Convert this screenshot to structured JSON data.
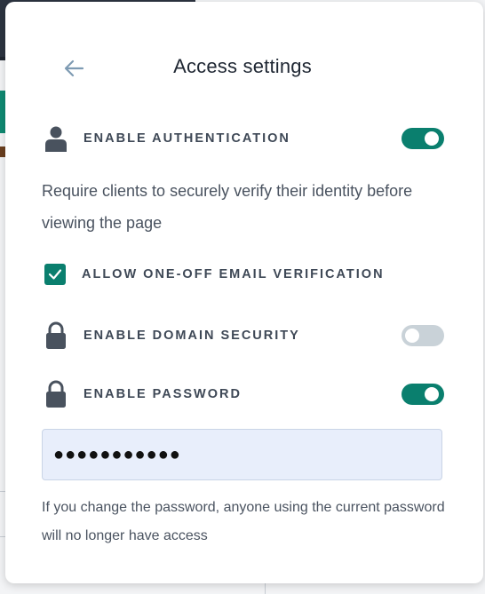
{
  "panel": {
    "title": "Access settings",
    "back_icon": "arrow-left-icon"
  },
  "authentication": {
    "label": "ENABLE AUTHENTICATION",
    "enabled": true,
    "description": "Require clients to securely verify their identity before viewing the page"
  },
  "email_verification": {
    "label": "ALLOW ONE-OFF EMAIL VERIFICATION",
    "checked": true
  },
  "domain_security": {
    "label": "ENABLE DOMAIN SECURITY",
    "enabled": false
  },
  "password": {
    "label": "ENABLE PASSWORD",
    "enabled": true,
    "masked_value": "●●●●●●●●●●●",
    "note": "If you change the password, anyone using the current password will no longer have access"
  },
  "colors": {
    "accent": "#0a7f6e",
    "toggle_off": "#c9d2d8",
    "field_bg": "#e8eefb"
  }
}
